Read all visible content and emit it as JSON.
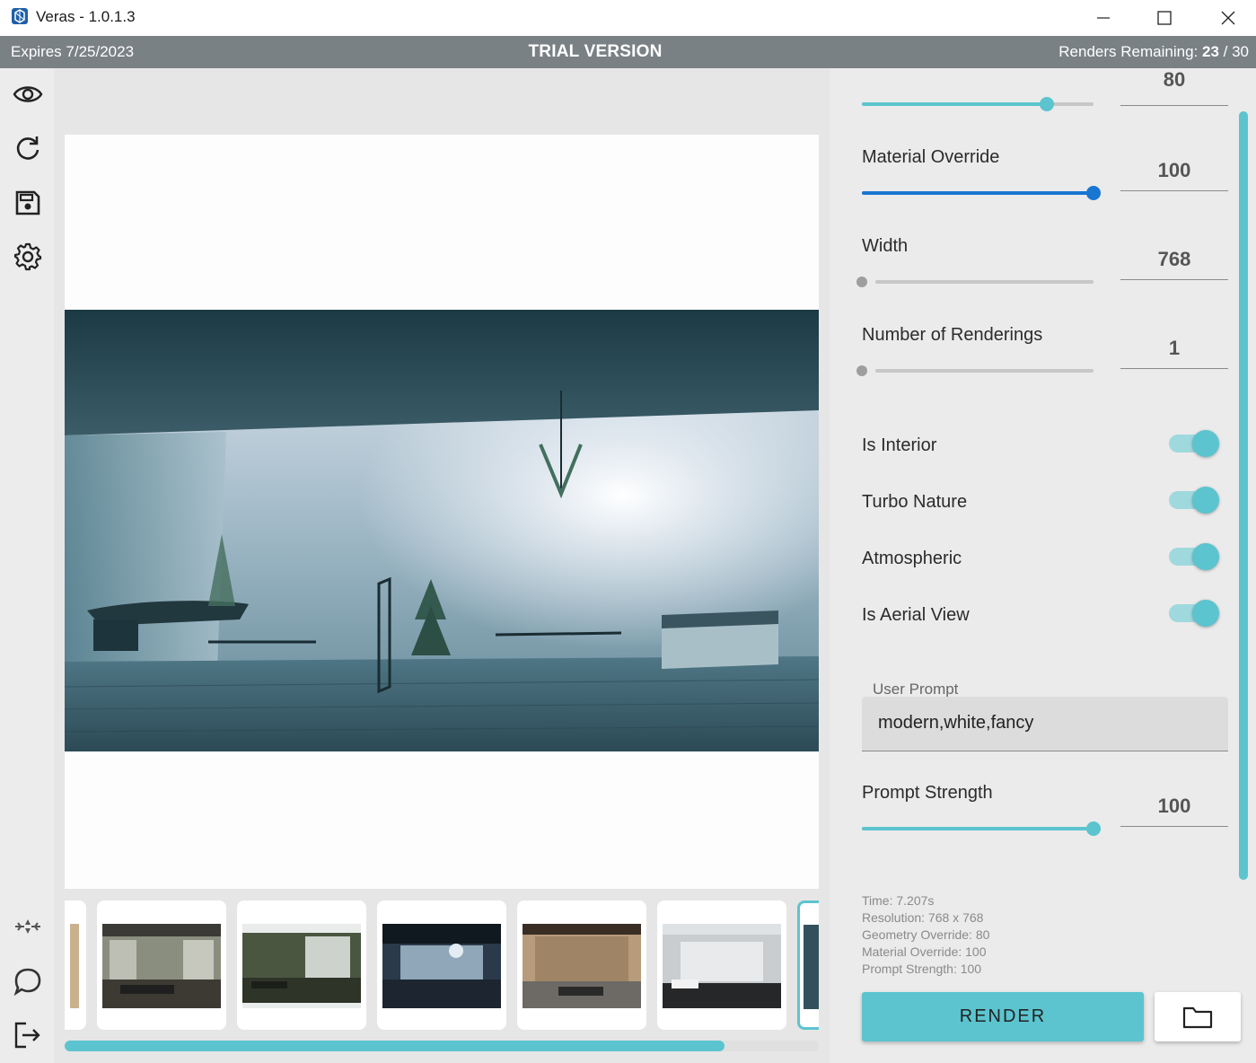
{
  "window": {
    "title": "Veras - 1.0.1.3"
  },
  "banner": {
    "expires": "Expires 7/25/2023",
    "trial": "TRIAL VERSION",
    "renders_label": "Renders Remaining:",
    "renders_used": "23",
    "renders_sep": " / ",
    "renders_total": "30"
  },
  "toolbar": {
    "icons": [
      "eye-icon",
      "refresh-icon",
      "save-icon",
      "gear-icon",
      "drone-icon",
      "chat-icon",
      "logout-icon"
    ]
  },
  "controls": {
    "top_partial": {
      "value": "80",
      "fraction": 0.8
    },
    "material_override": {
      "label": "Material Override",
      "value": "100",
      "fraction": 1.0
    },
    "width": {
      "label": "Width",
      "value": "768",
      "fraction": 0.0
    },
    "num_renderings": {
      "label": "Number of Renderings",
      "value": "1",
      "fraction": 0.0
    },
    "toggles": [
      {
        "label": "Is Interior",
        "on": true
      },
      {
        "label": "Turbo Nature",
        "on": true
      },
      {
        "label": "Atmospheric",
        "on": true
      },
      {
        "label": "Is Aerial View",
        "on": true
      }
    ],
    "user_prompt": {
      "label": "User Prompt",
      "value": "modern,white,fancy"
    },
    "prompt_strength": {
      "label": "Prompt Strength",
      "value": "100",
      "fraction": 1.0
    }
  },
  "info": {
    "time": "Time: 7.207s",
    "resolution": "Resolution: 768 x 768",
    "geometry": "Geometry Override: 80",
    "material": "Material Override: 100",
    "prompt_strength": "Prompt Strength: 100"
  },
  "actions": {
    "render_label": "RENDER"
  },
  "colors": {
    "accent": "#5bc4cf",
    "blue": "#1976d2",
    "banner": "#7a8185"
  }
}
